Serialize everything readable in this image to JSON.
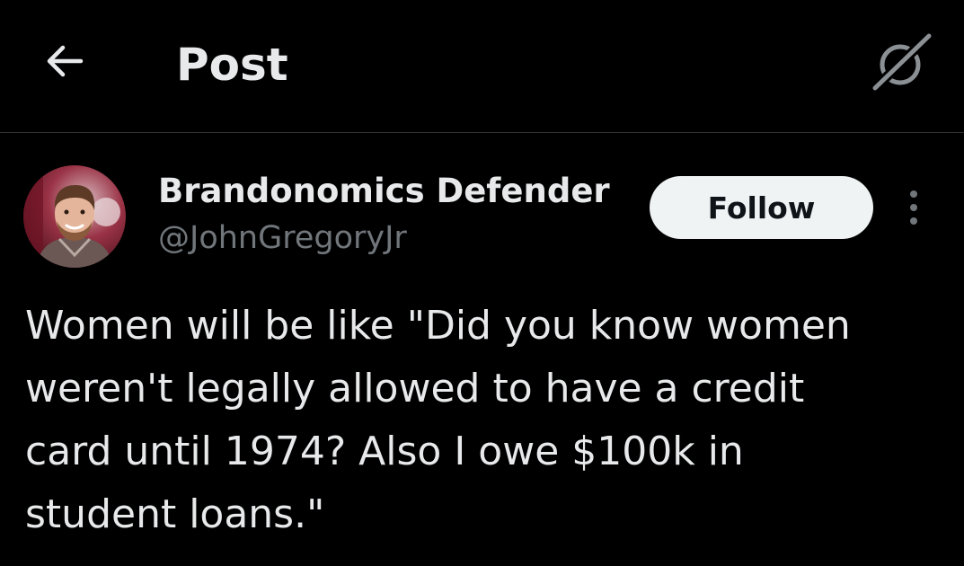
{
  "header": {
    "back_icon": "arrow-left-icon",
    "title": "Post",
    "grok_icon": "grok-icon"
  },
  "post": {
    "author": {
      "display_name": "Brandonomics Defender",
      "handle": "@JohnGregoryJr",
      "avatar_icon": "user-avatar"
    },
    "follow_label": "Follow",
    "more_icon": "more-vertical-icon",
    "text": "Women will be like \"Did you know women\nweren't legally allowed to have a credit\ncard until 1974? Also I owe $100k in\nstudent loans.\""
  },
  "colors": {
    "background": "#000000",
    "primary_text": "#e7e9ea",
    "secondary_text": "#71767b",
    "divider": "#2f3336",
    "follow_bg": "#eff3f4",
    "follow_text": "#0f1419"
  }
}
